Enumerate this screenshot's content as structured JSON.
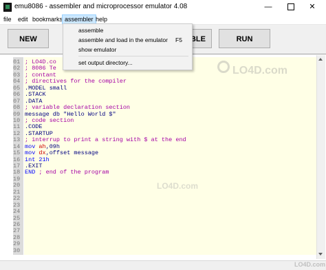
{
  "window": {
    "title": "emu8086 - assembler and microprocessor emulator 4.08"
  },
  "menubar": {
    "items": [
      "file",
      "edit",
      "bookmarks",
      "assembler",
      "help"
    ]
  },
  "toolbar": {
    "new_label": "NEW",
    "assemble_label": "MBLE",
    "run_label": "RUN"
  },
  "dropdown": {
    "items": [
      {
        "label": "assemble",
        "shortcut": ""
      },
      {
        "label": "assemble and load in the emulator",
        "shortcut": "F5"
      },
      {
        "label": "show emulator",
        "shortcut": ""
      },
      {
        "label": "set output directory...",
        "shortcut": ""
      }
    ]
  },
  "editor": {
    "lines": [
      {
        "num": "01",
        "parts": [
          {
            "t": "; LO4D.co",
            "c": "comment"
          }
        ]
      },
      {
        "num": "02",
        "parts": [
          {
            "t": "; 8086 Te",
            "c": "comment"
          }
        ]
      },
      {
        "num": "03",
        "parts": [
          {
            "t": "; contant",
            "c": "comment"
          }
        ]
      },
      {
        "num": "04",
        "parts": [
          {
            "t": "; directives for the compiler",
            "c": "comment"
          }
        ]
      },
      {
        "num": "05",
        "parts": [
          {
            "t": ".MODEL small",
            "c": "directive"
          }
        ]
      },
      {
        "num": "06",
        "parts": [
          {
            "t": ".STACK",
            "c": "directive"
          }
        ]
      },
      {
        "num": "07",
        "parts": [
          {
            "t": ".DATA",
            "c": "directive"
          }
        ]
      },
      {
        "num": "08",
        "parts": [
          {
            "t": "; variable declaration section",
            "c": "comment"
          }
        ]
      },
      {
        "num": "09",
        "parts": [
          {
            "t": "message db \"Hello World $\"",
            "c": "string"
          }
        ]
      },
      {
        "num": "10",
        "parts": [
          {
            "t": "; code section",
            "c": "comment"
          }
        ]
      },
      {
        "num": "11",
        "parts": [
          {
            "t": ".CODE",
            "c": "directive"
          }
        ]
      },
      {
        "num": "12",
        "parts": [
          {
            "t": ".STARTUP",
            "c": "directive"
          }
        ]
      },
      {
        "num": "13",
        "parts": [
          {
            "t": "; interrup to print a string with $ at the end",
            "c": "comment"
          }
        ]
      },
      {
        "num": "14",
        "parts": [
          {
            "t": "mov ",
            "c": "kw"
          },
          {
            "t": "ah",
            "c": "reg"
          },
          {
            "t": ",09h",
            "c": "plain"
          }
        ]
      },
      {
        "num": "15",
        "parts": [
          {
            "t": "mov ",
            "c": "kw"
          },
          {
            "t": "dx",
            "c": "reg"
          },
          {
            "t": ",offset message",
            "c": "plain"
          }
        ]
      },
      {
        "num": "16",
        "parts": [
          {
            "t": "int 21h",
            "c": "kw"
          }
        ]
      },
      {
        "num": "17",
        "parts": [
          {
            "t": ".EXIT",
            "c": "directive"
          }
        ]
      },
      {
        "num": "18",
        "parts": [
          {
            "t": "END ",
            "c": "kw"
          },
          {
            "t": "; end of the program",
            "c": "comment"
          }
        ]
      },
      {
        "num": "19",
        "parts": []
      },
      {
        "num": "20",
        "parts": []
      },
      {
        "num": "21",
        "parts": []
      },
      {
        "num": "22",
        "parts": []
      },
      {
        "num": "23",
        "parts": []
      },
      {
        "num": "24",
        "parts": []
      },
      {
        "num": "25",
        "parts": []
      },
      {
        "num": "26",
        "parts": []
      },
      {
        "num": "27",
        "parts": []
      },
      {
        "num": "28",
        "parts": []
      },
      {
        "num": "29",
        "parts": []
      },
      {
        "num": "30",
        "parts": []
      }
    ]
  },
  "watermarks": {
    "main": "LO4D.com",
    "editor": "LO4D.com",
    "corner": "LO4D.com"
  },
  "colors": {
    "menu_highlight": "#cce8ff",
    "code_background": "#ffffe6",
    "comment": "#a400a4",
    "keyword": "#0000ff",
    "register": "#cc0000"
  }
}
